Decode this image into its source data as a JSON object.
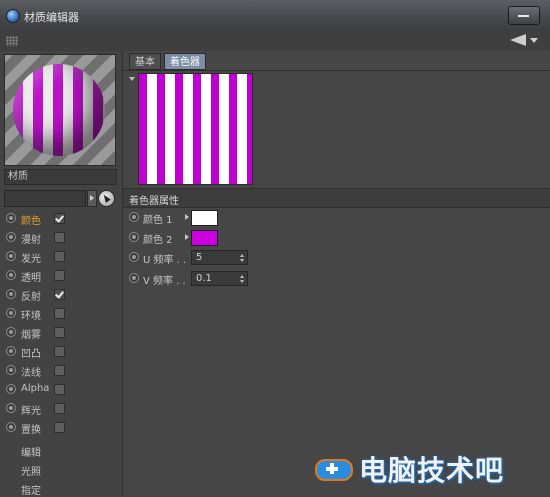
{
  "window": {
    "title": "材质编辑器"
  },
  "material": {
    "name": "材质"
  },
  "channels": [
    {
      "label": "颜色",
      "checked": true,
      "active": true
    },
    {
      "label": "漫射",
      "checked": false,
      "active": false
    },
    {
      "label": "发光",
      "checked": false,
      "active": false
    },
    {
      "label": "透明",
      "checked": false,
      "active": false
    },
    {
      "label": "反射",
      "checked": true,
      "active": false
    },
    {
      "label": "环境",
      "checked": false,
      "active": false
    },
    {
      "label": "烟雾",
      "checked": false,
      "active": false
    },
    {
      "label": "凹凸",
      "checked": false,
      "active": false
    },
    {
      "label": "法线",
      "checked": false,
      "active": false
    },
    {
      "label": "Alpha",
      "checked": false,
      "active": false
    },
    {
      "label": "辉光",
      "checked": false,
      "active": false
    },
    {
      "label": "置换",
      "checked": false,
      "active": false
    }
  ],
  "extras": [
    "编辑",
    "光照",
    "指定"
  ],
  "tabs": {
    "basic": "基本",
    "shader": "着色器"
  },
  "properties": {
    "title": "着色器属性",
    "color1": {
      "label": "颜色 1",
      "value": "#ffffff"
    },
    "color2": {
      "label": "颜色 2",
      "value": "#cc00e0"
    },
    "u_freq": {
      "label": "U 频率 . .",
      "value": "5"
    },
    "v_freq": {
      "label": "V 频率 . .",
      "value": "0.1"
    }
  },
  "watermark": {
    "text": "电脑技术吧"
  }
}
